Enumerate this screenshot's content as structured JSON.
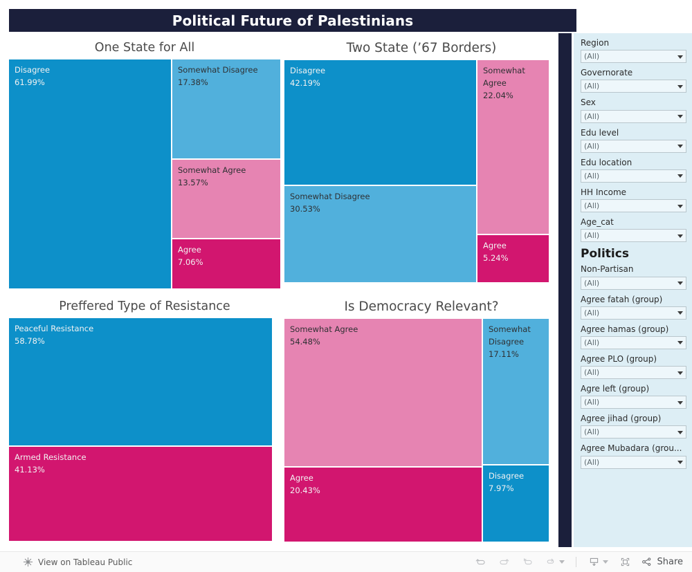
{
  "header": {
    "title": "Political Future of Palestinians",
    "banner_color": "#1b1f3b"
  },
  "palette": {
    "blue": "#0d90c9",
    "light_blue": "#51b0dc",
    "pink": "#e684b2",
    "crimson": "#d2166f",
    "sidebar_bg": "#ddeef5",
    "rail": "#1b1f3b"
  },
  "chart_data": [
    {
      "id": "one-state-for-all",
      "type": "treemap",
      "title": "One State for All",
      "categories": [
        "Disagree",
        "Somewhat Disagree",
        "Somewhat Agree",
        "Agree"
      ],
      "values": [
        61.99,
        17.38,
        13.57,
        7.06
      ],
      "value_labels": [
        "61.99%",
        "17.38%",
        "13.57%",
        "7.06%"
      ],
      "colors": [
        "#0d90c9",
        "#51b0dc",
        "#e684b2",
        "#d2166f"
      ],
      "text_colors": [
        "light",
        "dark",
        "dark",
        "light"
      ],
      "xlabel": "",
      "ylabel": ""
    },
    {
      "id": "two-state-67-borders",
      "type": "treemap",
      "title": "Two State (’67 Borders)",
      "categories": [
        "Disagree",
        "Somewhat Disagree",
        "Somewhat Agree",
        "Agree"
      ],
      "values": [
        42.19,
        30.53,
        22.04,
        5.24
      ],
      "value_labels": [
        "42.19%",
        "30.53%",
        "22.04%",
        "5.24%"
      ],
      "colors": [
        "#0d90c9",
        "#51b0dc",
        "#e684b2",
        "#d2166f"
      ],
      "text_colors": [
        "light",
        "dark",
        "dark",
        "light"
      ],
      "xlabel": "",
      "ylabel": ""
    },
    {
      "id": "preffered-type-of-resistance",
      "type": "treemap",
      "title": "Preffered Type of Resistance",
      "categories": [
        "Peaceful Resistance",
        "Armed Resistance"
      ],
      "values": [
        58.78,
        41.13
      ],
      "value_labels": [
        "58.78%",
        "41.13%"
      ],
      "colors": [
        "#0d90c9",
        "#d2166f"
      ],
      "text_colors": [
        "light",
        "light"
      ],
      "xlabel": "",
      "ylabel": ""
    },
    {
      "id": "is-democracy-relevant",
      "type": "treemap",
      "title": "Is Democracy Relevant?",
      "categories": [
        "Somewhat Agree",
        "Agree",
        "Somewhat Disagree",
        "Disagree"
      ],
      "values": [
        54.48,
        20.43,
        17.11,
        7.97
      ],
      "value_labels": [
        "54.48%",
        "20.43%",
        "17.11%",
        "7.97%"
      ],
      "colors": [
        "#e684b2",
        "#d2166f",
        "#51b0dc",
        "#0d90c9"
      ],
      "text_colors": [
        "dark",
        "light",
        "dark",
        "light"
      ],
      "xlabel": "",
      "ylabel": ""
    }
  ],
  "sidebar": {
    "filters": [
      {
        "label": "Region",
        "value": "(All)"
      },
      {
        "label": "Governorate",
        "value": "(All)"
      },
      {
        "label": "Sex",
        "value": "(All)"
      },
      {
        "label": "Edu level",
        "value": "(All)"
      },
      {
        "label": "Edu location",
        "value": "(All)"
      },
      {
        "label": "HH Income",
        "value": "(All)"
      },
      {
        "label": "Age_cat",
        "value": "(All)"
      }
    ],
    "section_heading": "Politics",
    "politics_filters": [
      {
        "label": "Non-Partisan",
        "value": "(All)"
      },
      {
        "label": "Agree fatah (group)",
        "value": "(All)"
      },
      {
        "label": "Agree hamas (group)",
        "value": "(All)"
      },
      {
        "label": "Agree PLO (group)",
        "value": "(All)"
      },
      {
        "label": "Agre left (group)",
        "value": "(All)"
      },
      {
        "label": "Agree jihad (group)",
        "value": "(All)"
      },
      {
        "label": "Agree Mubadara (grou...",
        "value": "(All)"
      }
    ]
  },
  "toolbar": {
    "view_on_tableau_public": "View on Tableau Public",
    "share_label": "Share"
  }
}
